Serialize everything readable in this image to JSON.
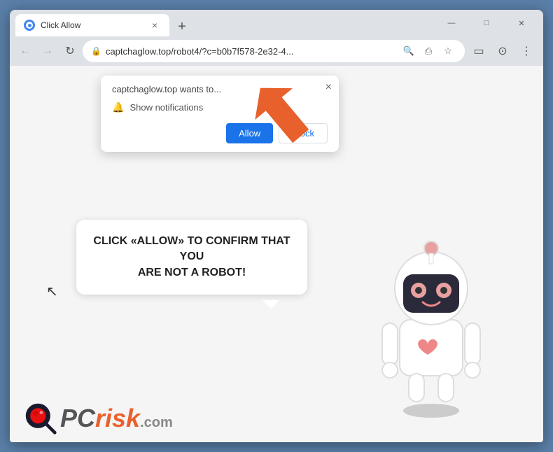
{
  "browser": {
    "title": "Click Allow",
    "url": "captchaglow.top/robot4/?c=b0b7f578-2e32-4...",
    "tab": {
      "title": "Click Allow",
      "close_label": "×"
    },
    "new_tab_label": "+",
    "window_controls": {
      "minimize": "—",
      "maximize": "□",
      "close": "✕"
    },
    "nav": {
      "back": "←",
      "forward": "→",
      "refresh": "↻"
    }
  },
  "notification_popup": {
    "site": "captchaglow.top wants to...",
    "notification_text": "Show notifications",
    "allow_label": "Allow",
    "block_label": "Block",
    "close_label": "×"
  },
  "speech_bubble": {
    "line1": "CLICK «ALLOW» TO CONFIRM THAT YOU",
    "line2": "ARE NOT A ROBOT!"
  },
  "pcrisk": {
    "pc_text": "PC",
    "risk_text": "risk",
    "com_text": ".com"
  },
  "colors": {
    "accent_orange": "#e8612c",
    "browser_bg": "#dee1e6",
    "allow_btn": "#1a73e8",
    "page_bg": "#f5f5f5"
  }
}
